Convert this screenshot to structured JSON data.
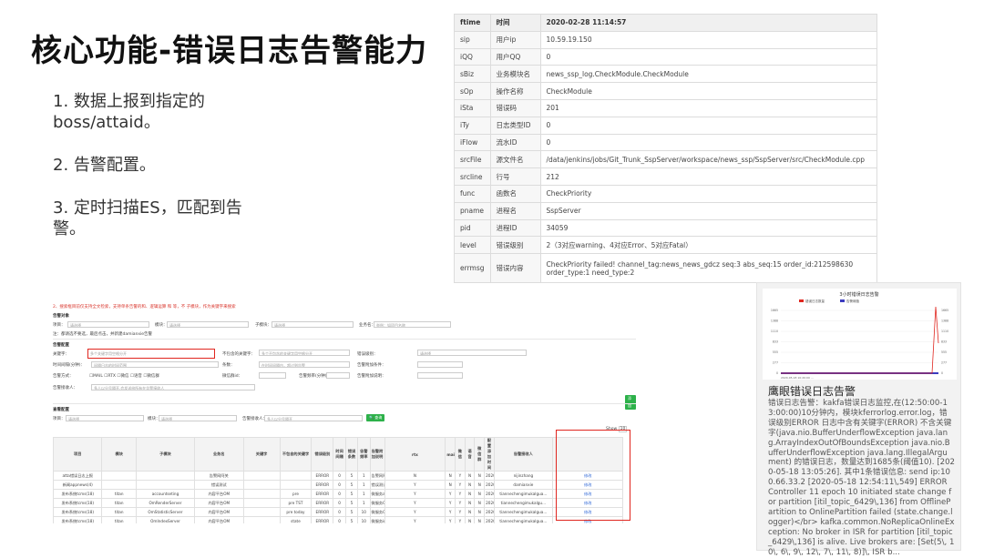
{
  "slide": {
    "title": "核心功能-错误日志告警能力",
    "points": [
      "1. 数据上报到指定的boss/attaid。",
      "2. 告警配置。",
      "3. 定时扫描ES，匹配到告警。"
    ]
  },
  "field_table": {
    "header": [
      "ftime",
      "时间",
      "2020-02-28 11:14:57"
    ],
    "rows": [
      [
        "sip",
        "用户ip",
        "10.59.19.150"
      ],
      [
        "iQQ",
        "用户QQ",
        "0"
      ],
      [
        "sBiz",
        "业务模块名",
        "news_ssp_log.CheckModule.CheckModule"
      ],
      [
        "sOp",
        "操作名称",
        "CheckModule"
      ],
      [
        "iSta",
        "错误码",
        "201"
      ],
      [
        "iTy",
        "日志类型ID",
        "0"
      ],
      [
        "iFlow",
        "流水ID",
        "0"
      ],
      [
        "srcFile",
        "源文件名",
        "/data/jenkins/jobs/Git_Trunk_SspServer/workspace/news_ssp/SspServer/src/CheckModule.cpp"
      ],
      [
        "srcline",
        "行号",
        "212"
      ],
      [
        "func",
        "函数名",
        "CheckPriority"
      ],
      [
        "pname",
        "进程名",
        "SspServer"
      ],
      [
        "pid",
        "进程ID",
        "34059"
      ],
      [
        "level",
        "错误级别",
        "2（3对应warning、4对应Error、5对应Fatal）"
      ],
      [
        "errmsg",
        "错误内容",
        "CheckPriority failed! channel_tag:news_news_gdcz seq:3 abs_seq:15 order_id:212598630 order_type:1 need_type:2"
      ]
    ]
  },
  "form": {
    "notice": "2、搜索框目前仅支持全文检索，支持单条告警的和、逻辑运算 和 等，不 子模块，作为关键字来搜索",
    "section_object": "告警对象",
    "project_label": "项目：",
    "project_placeholder": "请选择",
    "module_label": "模块：",
    "module_placeholder": "请选择",
    "submodule_label": "子模块：",
    "submodule_placeholder": "请选择",
    "business_label": "业务名：",
    "business_placeholder": "举例：如项目名称",
    "hint": "注：都请选不要选，最后点击，并新建damianxie告警",
    "section_config": "告警配置",
    "keyword_label": "关键字：",
    "keyword_placeholder": "多个关键字用空格分开",
    "exclude_label": "不包含的关键字：",
    "exclude_placeholder": "多个不包含的关键字用空格分开",
    "level_label": "错误级别：",
    "level_placeholder": "请选择",
    "interval_label": "时间间隔(分钟)：",
    "interval_placeholder": "间隔日志的时间范围",
    "count_label": "条数：",
    "count_placeholder": "在时间间隔内，超过则告警",
    "extra_label": "告警附加条件：",
    "method_label": "告警方式：",
    "methods": [
      "MAIL",
      "RTX",
      "微信",
      "语音",
      "微信群"
    ],
    "group_label": "微信群id：",
    "freq_label": "告警频率(分钟)：",
    "extra_info_label": "告警附加说明：",
    "receiver_label": "告警接收人：",
    "receiver_placeholder": "多人以分号隔开,会发送给所有在告警接收人",
    "add_button": "添加",
    "section_query": "查看配置",
    "query_project_label": "项目：",
    "query_module_label": "模块：",
    "query_receiver_label": "告警接收人：",
    "query_receiver_placeholder": "多人以分号隔开",
    "query_button": "查询",
    "show_label": "Show",
    "show_value": "10"
  },
  "config_table": {
    "headers": [
      "项目",
      "模块",
      "子模块",
      "业务名",
      "关键字",
      "不包含的关键字",
      "错误级别",
      "时间间隔",
      "错误条数",
      "告警频率",
      "rtx",
      "mail",
      "微信",
      "语音",
      "微信群",
      "告警附加说明",
      "配置添加时间",
      "告警接收人",
      ""
    ],
    "rows": [
      [
        "atta错误日志上报",
        "",
        "",
        "告警网阿关",
        "",
        "",
        "ERROR",
        "0",
        "5",
        "1",
        "5",
        "告警网阿关通用告警",
        "N",
        "N",
        "Y",
        "N",
        "N",
        "2020-05-15 11:11...",
        "nijinzhang",
        "修改"
      ],
      [
        "新闻appnews(4)",
        "",
        "",
        "错误测试",
        "",
        "",
        "ERROR",
        "0",
        "5",
        "1",
        "5",
        "错误测试",
        "Y",
        "N",
        "Y",
        "N",
        "N",
        "2020-05-08 14:48...",
        "damianxie",
        "修改"
      ],
      [
        "发布系统tcms(18)",
        "titan",
        "accountseting",
        "内容平台OM",
        "",
        "pre",
        "ERROR",
        "0",
        "5",
        "1",
        "5",
        "微服务accountseting告警",
        "Y",
        "Y",
        "Y",
        "N",
        "N",
        "2020-05-07 12:42...",
        "tiannechengimukalgua...",
        "修改"
      ],
      [
        "发布系统tcms(18)",
        "titan",
        "OmRenderServer",
        "内容平台OM",
        "",
        "pre TST",
        "ERROR",
        "0",
        "5",
        "1",
        "5",
        "微服务OmRenderServer告警",
        "Y",
        "Y",
        "Y",
        "N",
        "N",
        "2020-05-07 12:42...",
        "tiannechengimukalgu...",
        "修改"
      ],
      [
        "发布系统tcms(18)",
        "titan",
        "OmStatisticServer",
        "内容平台OM",
        "",
        "pre today",
        "ERROR",
        "0",
        "5",
        "10",
        "5",
        "微服务OmStatisticServer告警",
        "Y",
        "Y",
        "Y",
        "N",
        "N",
        "2020-05-07 12:42...",
        "tiannechengimukalgua...",
        "修改"
      ],
      [
        "发布系统tcms(18)",
        "titan",
        "OmIndexServer",
        "内容平台OM",
        "",
        "state",
        "ERROR",
        "0",
        "5",
        "10",
        "5",
        "微服务index告警",
        "Y",
        "Y",
        "Y",
        "N",
        "N",
        "2020-05-07 12:42...",
        "tiannechengimukalgua...",
        "修改"
      ],
      [
        "发布系统tcms(18)",
        "titan",
        "OmOtherServer",
        "内容平台OM",
        "",
        "pre TST",
        "ERROR",
        "0",
        "5",
        "1",
        "5",
        "微服务other告警",
        "Y",
        "Y",
        "Y",
        "N",
        "N",
        "2020-05-07 12:42...",
        "tiannechengimukalgua...",
        "修改"
      ]
    ]
  },
  "alert_card": {
    "chart_title": "3小时错误日志告警",
    "legend": [
      "错误日志数量",
      "告警阈值"
    ],
    "y_ticks": [
      "1665",
      "1388",
      "1110",
      "833",
      "555",
      "277",
      "0"
    ],
    "right_ticks": [
      "1665",
      "1388",
      "1110",
      "833",
      "555",
      "277",
      "0"
    ],
    "x_tick": "2020-05-18 10:20:00 ...",
    "title": "鹰眼错误日志告警",
    "body": "错误日志告警：kakfa错误日志监控,在(12:50:00-13:00:00)10分钟内，模块kferrorlog.error.log，错误级别ERROR 日志中含有关键字(ERROR) 不含关键字(java.nio.BufferUnderflowException java.lang.ArrayIndexOutOfBoundsException java.nio.BufferUnderflowException java.lang.IllegalArgument) 的错误日志，数量达到1685条(阈值10). [2020-05-18 13:05:26]. 其中1条错误信息: send ip:100.66.33.2 [2020-05-18 12:54:11\\,549] ERROR Controller 11 epoch 10 initiated state change for partition [itil_topic_6429\\,136] from OfflinePartition to OnlinePartition failed (state.change.logger)</br> kafka.common.NoReplicaOnlineException: No broker in ISR for partition [itil_topic_6429\\,136] is alive. Live brokers are: [Set(5\\, 10\\, 6\\, 9\\, 12\\, 7\\, 11\\, 8)]\\, ISR b...",
    "colors": {
      "series": "#e0261f",
      "threshold": "#3b3bbf"
    }
  }
}
